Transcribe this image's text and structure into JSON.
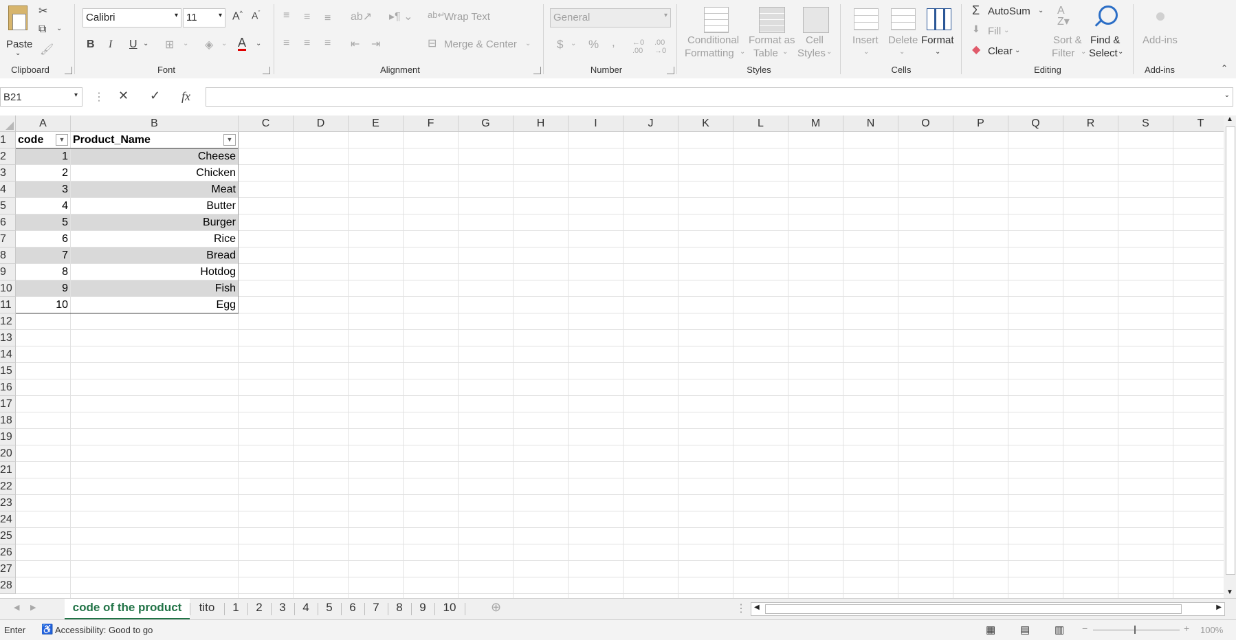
{
  "ribbon": {
    "clipboard": {
      "paste": "Paste",
      "group": "Clipboard"
    },
    "font": {
      "name": "Calibri",
      "size": "11",
      "bold": "B",
      "italic": "I",
      "underline": "U",
      "group": "Font"
    },
    "alignment": {
      "wrap": "Wrap Text",
      "merge": "Merge & Center",
      "group": "Alignment"
    },
    "number": {
      "format": "General",
      "currency": "$",
      "percent": "%",
      "comma": ",",
      "group": "Number"
    },
    "styles": {
      "conditional1": "Conditional",
      "conditional2": "Formatting",
      "table1": "Format as",
      "table2": "Table",
      "cell1": "Cell",
      "cell2": "Styles",
      "group": "Styles"
    },
    "cells": {
      "insert": "Insert",
      "delete": "Delete",
      "format": "Format",
      "group": "Cells"
    },
    "editing": {
      "autosum": "AutoSum",
      "fill": "Fill",
      "clear": "Clear",
      "sort1": "Sort &",
      "sort2": "Filter",
      "find1": "Find &",
      "find2": "Select",
      "group": "Editing"
    },
    "addins": {
      "label": "Add-ins",
      "group": "Add-ins"
    }
  },
  "formula_bar": {
    "namebox": "B21",
    "fx": "fx",
    "value": ""
  },
  "columns": [
    "A",
    "B",
    "C",
    "D",
    "E",
    "F",
    "G",
    "H",
    "I",
    "J",
    "K",
    "L",
    "M",
    "N",
    "O",
    "P",
    "Q",
    "R",
    "S",
    "T"
  ],
  "rows": [
    "1",
    "2",
    "3",
    "4",
    "5",
    "6",
    "7",
    "8",
    "9",
    "10",
    "11",
    "12",
    "13",
    "14",
    "15",
    "16",
    "17",
    "18",
    "19",
    "20",
    "21",
    "22",
    "23",
    "24",
    "25",
    "26",
    "27",
    "28"
  ],
  "table": {
    "headers": [
      "code",
      "Product_Name"
    ],
    "rows": [
      [
        "1",
        "Cheese"
      ],
      [
        "2",
        "Chicken"
      ],
      [
        "3",
        "Meat"
      ],
      [
        "4",
        "Butter"
      ],
      [
        "5",
        "Burger"
      ],
      [
        "6",
        "Rice"
      ],
      [
        "7",
        "Bread"
      ],
      [
        "8",
        "Hotdog"
      ],
      [
        "9",
        "Fish"
      ],
      [
        "10",
        "Egg"
      ]
    ]
  },
  "sheets": [
    "code of the product",
    "tito",
    "1",
    "2",
    "3",
    "4",
    "5",
    "6",
    "7",
    "8",
    "9",
    "10"
  ],
  "status": {
    "mode": "Enter",
    "accessibility": "Accessibility: Good to go",
    "zoom": "100%"
  },
  "colors": {
    "accent": "#217346",
    "band": "#d9d9d9"
  }
}
